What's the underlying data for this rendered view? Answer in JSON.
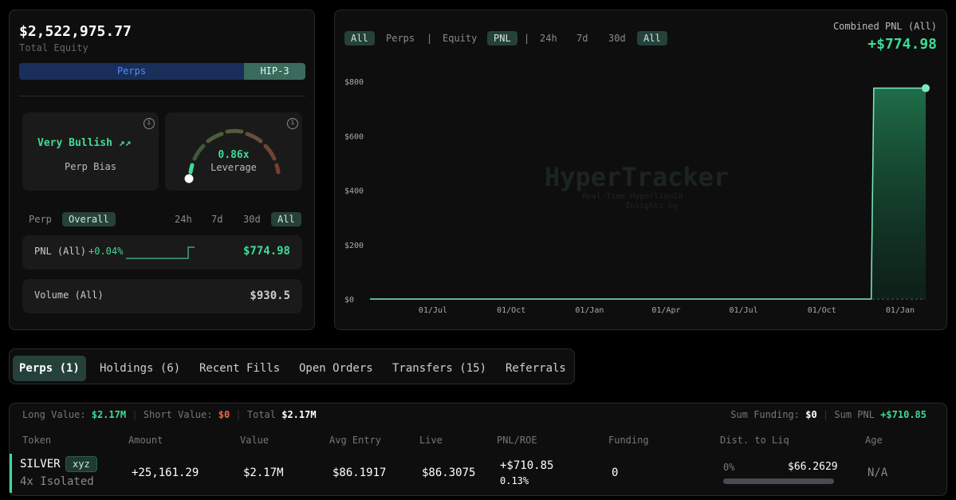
{
  "account": {
    "total_equity": "$2,522,975.77",
    "total_equity_label": "Total Equity",
    "segments": [
      {
        "label": "Perps"
      },
      {
        "label": "HIP-3"
      }
    ]
  },
  "bias": {
    "value": "Very Bullish",
    "icon": "trending-up-icon",
    "label": "Perp Bias"
  },
  "leverage": {
    "value": "0.86x",
    "label": "Leverage",
    "level_fraction": 0.05
  },
  "stats_filters": {
    "scope": [
      "Perp",
      "Overall"
    ],
    "scope_selected": "Overall",
    "periods": [
      "24h",
      "7d",
      "30d",
      "All"
    ],
    "period_selected": "All"
  },
  "pnl_card": {
    "label": "PNL (All)",
    "change": "+0.04%",
    "value": "$774.98"
  },
  "volume_card": {
    "label": "Volume (All)",
    "value": "$930.5"
  },
  "chart_controls": {
    "items": [
      "All",
      "Perps",
      "|",
      "Equity",
      "PNL",
      "|",
      "24h",
      "7d",
      "30d",
      "All"
    ]
  },
  "combined": {
    "label": "Combined PNL (All)",
    "value": "+$774.98"
  },
  "watermark": {
    "title": "HyperTracker",
    "line1": "Real-Time Hyperliquid",
    "line2": "Insights by"
  },
  "chart_data": {
    "type": "area",
    "title": "Combined PNL (All)",
    "xlabel": "",
    "ylabel": "",
    "ylim": [
      0,
      800
    ],
    "yticks": [
      "$0",
      "$200",
      "$400",
      "$600",
      "$800"
    ],
    "ytick_values": [
      0,
      200,
      400,
      600,
      800
    ],
    "xlim": [
      "2024-04-18",
      "2026-01-31"
    ],
    "xticks": [
      {
        "date": "2024-07-01",
        "label": "01/Jul"
      },
      {
        "date": "2024-10-01",
        "label": "01/Oct"
      },
      {
        "date": "2025-01-01",
        "label": "01/Jan"
      },
      {
        "date": "2025-04-01",
        "label": "01/Apr"
      },
      {
        "date": "2025-07-01",
        "label": "01/Jul"
      },
      {
        "date": "2025-10-01",
        "label": "01/Oct"
      },
      {
        "date": "2026-01-01",
        "label": "01/Jan"
      }
    ],
    "series": [
      {
        "name": "PNL",
        "points": [
          [
            "2024-04-18",
            0
          ],
          [
            "2025-11-28",
            0
          ],
          [
            "2025-12-01",
            774.98
          ],
          [
            "2026-01-31",
            774.98
          ]
        ]
      }
    ],
    "colors": {
      "line": "#7ee8c6",
      "fill": "#1f6e48"
    }
  },
  "tabs": [
    {
      "label": "Perps (1)"
    },
    {
      "label": "Holdings (6)"
    },
    {
      "label": "Recent Fills"
    },
    {
      "label": "Open Orders"
    },
    {
      "label": "Transfers (15)"
    },
    {
      "label": "Referrals"
    }
  ],
  "summary": {
    "long_label": "Long Value:",
    "long_value": "$2.17M",
    "short_label": "Short Value:",
    "short_value": "$0",
    "total_label": "Total",
    "total_value": "$2.17M",
    "funding_label": "Sum Funding:",
    "funding_value": "$0",
    "pnl_label": "Sum PNL",
    "pnl_value": "+$710.85"
  },
  "table": {
    "columns": [
      "Token",
      "Amount",
      "Value",
      "Avg Entry",
      "Live",
      "PNL/ROE",
      "Funding",
      "Dist. to Liq",
      "Age"
    ],
    "rows": [
      {
        "token": "SILVER",
        "badge": "xyz",
        "mode": "4x Isolated",
        "amount": "+25,161.29",
        "value": "$2.17M",
        "avg_entry": "$86.1917",
        "live": "$86.3075",
        "pnl": "+$710.85",
        "roe": "0.13%",
        "funding": "0",
        "liq_pct": "0%",
        "liq_price": "$66.2629",
        "age": "N/A"
      }
    ]
  }
}
